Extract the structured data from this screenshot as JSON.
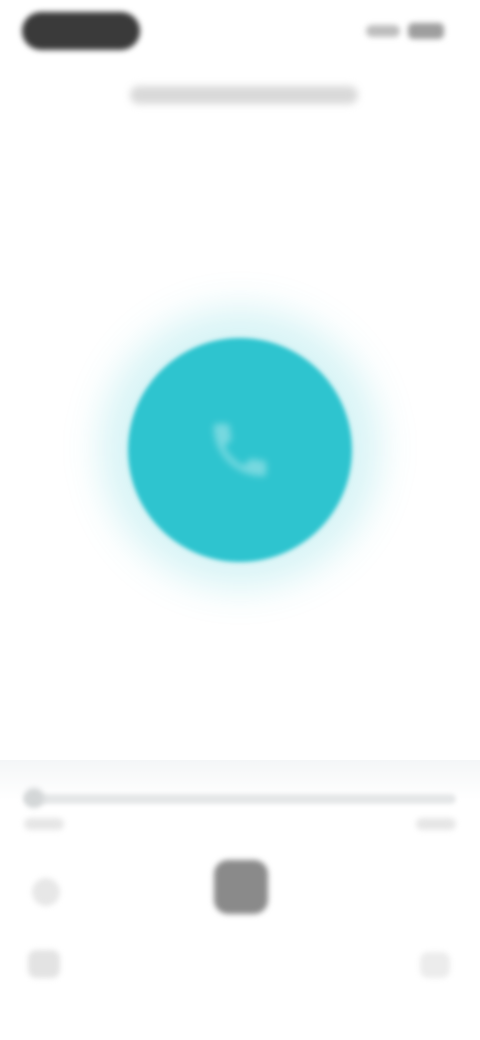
{
  "app": {
    "title": ""
  },
  "hero": {
    "icon": "phone-icon",
    "accent_color": "#2ec4cf"
  },
  "player": {
    "elapsed": "",
    "remaining": "",
    "progress": 0.0,
    "controls": {
      "prev_icon": "back-icon",
      "play_icon": "play-icon",
      "menu_icon": "menu-icon",
      "share_icon": "share-icon"
    }
  }
}
